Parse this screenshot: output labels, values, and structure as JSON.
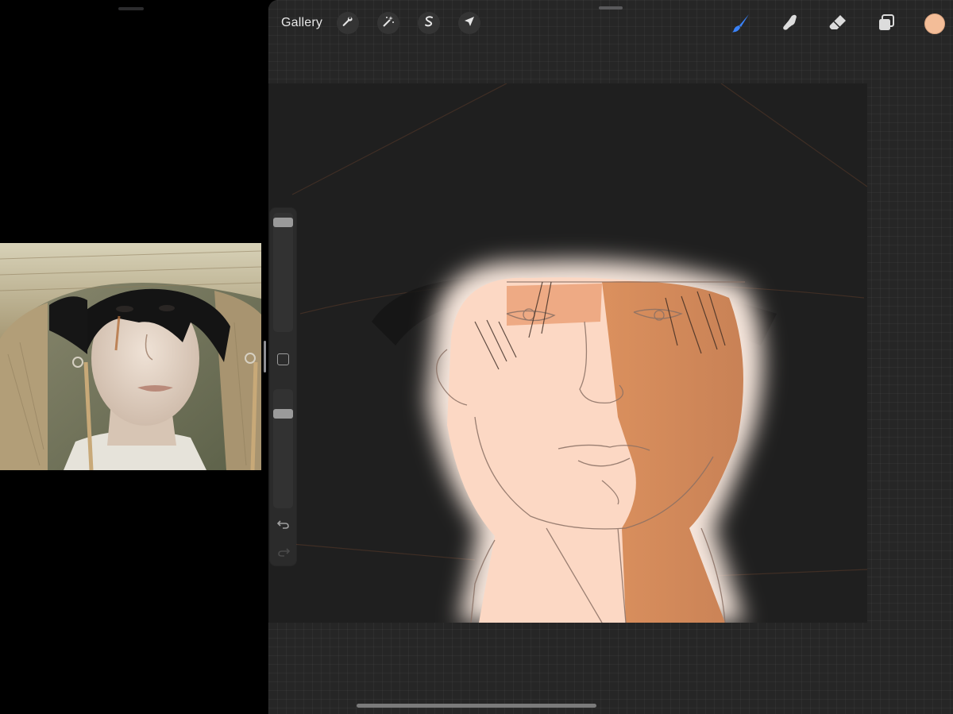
{
  "toolbar": {
    "gallery_label": "Gallery",
    "actions_icon": "wrench-icon",
    "adjustments_icon": "magic-wand-icon",
    "selection_icon": "selection-s-icon",
    "transform_icon": "arrow-cursor-icon",
    "brush_icon": "brush-icon",
    "smudge_icon": "smudge-finger-icon",
    "eraser_icon": "eraser-icon",
    "layers_icon": "layers-icon",
    "active_color": "#f3bd98",
    "active_tool_color": "#3a82f7"
  },
  "sidebar": {
    "brush_size_level": 0.0,
    "opacity_level": 0.0,
    "undo_icon": "undo-icon",
    "redo_icon": "redo-icon",
    "modify_icon": "square-icon"
  },
  "reference": {
    "description_icon": "reference-photo"
  }
}
